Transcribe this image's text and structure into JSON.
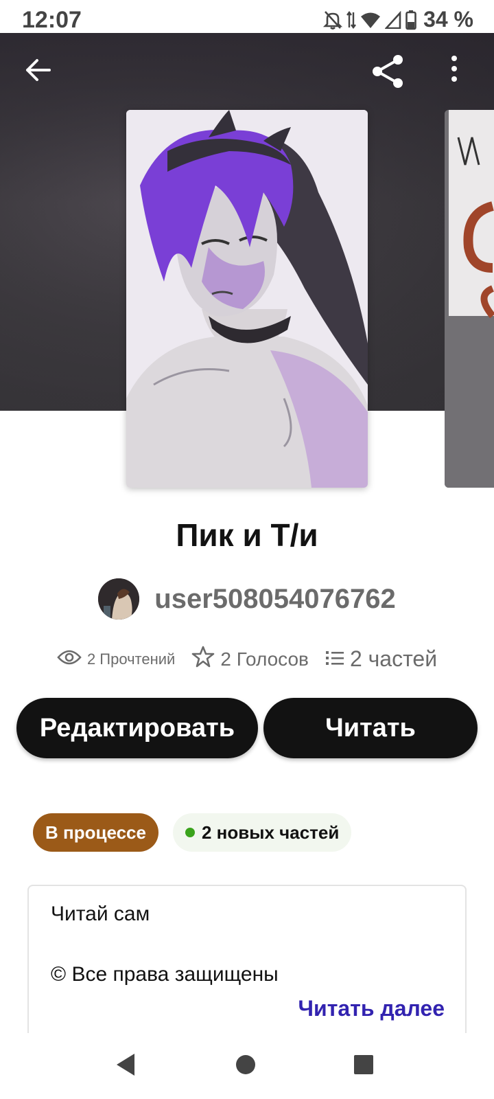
{
  "status_bar": {
    "time": "12:07",
    "battery": "34 %",
    "icons": [
      "bell-off-icon",
      "data-arrows-icon",
      "wifi-icon",
      "signal-icon",
      "battery-icon"
    ]
  },
  "header": {
    "icons": [
      "back-arrow-icon",
      "share-icon",
      "more-vertical-icon"
    ]
  },
  "story": {
    "title": "Пик и Т/и",
    "author": "user508054076762",
    "reads": "2 Прочтений",
    "votes": "2 Голосов",
    "parts": "2 частей"
  },
  "actions": {
    "edit_label": "Редактировать",
    "read_label": "Читать"
  },
  "badges": {
    "status": "В процессе",
    "new_parts": "2 новых частей"
  },
  "description": {
    "line1": "Читай сам",
    "line2": "© Все права защищены",
    "read_more": "Читать далее"
  },
  "nav": {
    "icons": [
      "nav-back-icon",
      "nav-home-icon",
      "nav-recent-icon"
    ]
  },
  "colors": {
    "button": "#121212",
    "status_badge": "#9b5a18",
    "new_dot": "#3aa31c",
    "read_more": "#3223b0"
  }
}
